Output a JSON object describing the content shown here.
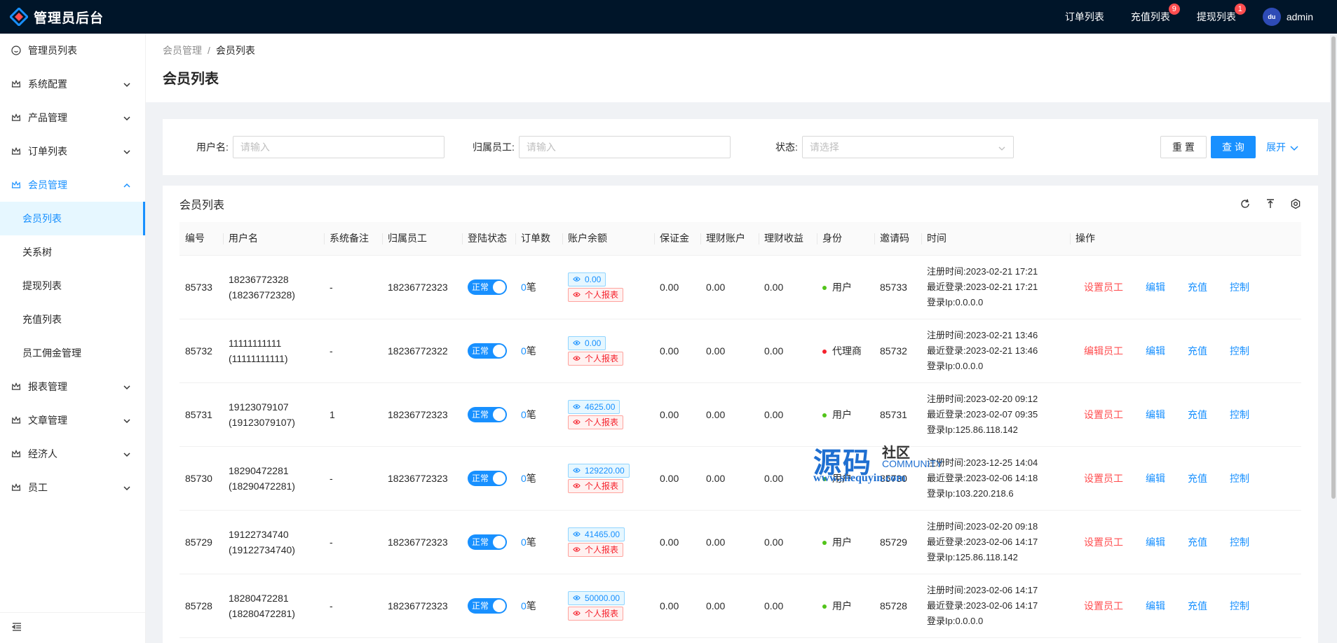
{
  "app": {
    "title": "管理员后台"
  },
  "topnav": [
    {
      "label": "订单列表",
      "badge": ""
    },
    {
      "label": "充值列表",
      "badge": "9"
    },
    {
      "label": "提现列表",
      "badge": "1"
    }
  ],
  "user": {
    "name": "admin",
    "avatar_text": "du"
  },
  "sidebar": {
    "items": [
      {
        "label": "管理员列表",
        "icon": "smile-icon",
        "expandable": false
      },
      {
        "label": "系统配置",
        "icon": "crown-icon",
        "expandable": true
      },
      {
        "label": "产品管理",
        "icon": "crown-icon",
        "expandable": true
      },
      {
        "label": "订单列表",
        "icon": "crown-icon",
        "expandable": true
      },
      {
        "label": "会员管理",
        "icon": "crown-icon",
        "expandable": true,
        "open": true,
        "children": [
          {
            "label": "会员列表",
            "selected": true
          },
          {
            "label": "关系树"
          },
          {
            "label": "提现列表"
          },
          {
            "label": "充值列表"
          },
          {
            "label": "员工佣金管理"
          }
        ]
      },
      {
        "label": "报表管理",
        "icon": "crown-icon",
        "expandable": true
      },
      {
        "label": "文章管理",
        "icon": "crown-icon",
        "expandable": true
      },
      {
        "label": "经济人",
        "icon": "crown-icon",
        "expandable": true
      },
      {
        "label": "员工",
        "icon": "crown-icon",
        "expandable": true
      }
    ]
  },
  "breadcrumb": {
    "parent": "会员管理",
    "sep": "/",
    "current": "会员列表"
  },
  "page_title": "会员列表",
  "search": {
    "username_label": "用户名:",
    "username_placeholder": "请输入",
    "staff_label": "归属员工:",
    "staff_placeholder": "请输入",
    "status_label": "状态:",
    "status_placeholder": "请选择",
    "reset": "重 置",
    "query": "查 询",
    "expand": "展开"
  },
  "table": {
    "title": "会员列表",
    "columns": [
      "编号",
      "用户名",
      "系统备注",
      "归属员工",
      "登陆状态",
      "订单数",
      "账户余额",
      "保证金",
      "理财账户",
      "理财收益",
      "身份",
      "邀请码",
      "时间",
      "操作"
    ],
    "switch_label": "正常",
    "count_suffix": "笔",
    "report_label": "个人报表",
    "reg_prefix": "注册时间:",
    "last_prefix": "最近登录:",
    "ip_prefix": "登录Ip:",
    "rows": [
      {
        "id": "85733",
        "user": "18236772328",
        "user2": "(18236772328)",
        "remark": "-",
        "staff": "18236772323",
        "orders": "0",
        "balance": "0.00",
        "deposit": "0.00",
        "finance": "0.00",
        "income": "0.00",
        "role": "用户",
        "role_color": "#52c41a",
        "code": "85733",
        "reg": "2023-02-21 17:21",
        "last": "2023-02-21 17:21",
        "ip": "0.0.0.0",
        "a1": "设置员工",
        "a2": "编辑",
        "a3": "充值",
        "a4": "控制"
      },
      {
        "id": "85732",
        "user": "11111111111",
        "user2": "(11111111111)",
        "remark": "-",
        "staff": "18236772322",
        "orders": "0",
        "balance": "0.00",
        "deposit": "0.00",
        "finance": "0.00",
        "income": "0.00",
        "role": "代理商",
        "role_color": "#f5222d",
        "code": "85732",
        "reg": "2023-02-21 13:46",
        "last": "2023-02-21 13:46",
        "ip": "0.0.0.0",
        "a1": "编辑员工",
        "a2": "编辑",
        "a3": "充值",
        "a4": "控制"
      },
      {
        "id": "85731",
        "user": "19123079107",
        "user2": "(19123079107)",
        "remark": "1",
        "staff": "18236772323",
        "orders": "0",
        "balance": "4625.00",
        "deposit": "0.00",
        "finance": "0.00",
        "income": "0.00",
        "role": "用户",
        "role_color": "#52c41a",
        "code": "85731",
        "reg": "2023-02-20 09:12",
        "last": "2023-02-07 09:35",
        "ip": "125.86.118.142",
        "a1": "设置员工",
        "a2": "编辑",
        "a3": "充值",
        "a4": "控制"
      },
      {
        "id": "85730",
        "user": "18290472281",
        "user2": "(18290472281)",
        "remark": "-",
        "staff": "18236772323",
        "orders": "0",
        "balance": "129220.00",
        "deposit": "0.00",
        "finance": "0.00",
        "income": "0.00",
        "role": "用户",
        "role_color": "#52c41a",
        "code": "85730",
        "reg": "2023-12-25 14:04",
        "last": "2023-02-06 14:18",
        "ip": "103.220.218.6",
        "a1": "设置员工",
        "a2": "编辑",
        "a3": "充值",
        "a4": "控制"
      },
      {
        "id": "85729",
        "user": "19122734740",
        "user2": "(19122734740)",
        "remark": "-",
        "staff": "18236772323",
        "orders": "0",
        "balance": "41465.00",
        "deposit": "0.00",
        "finance": "0.00",
        "income": "0.00",
        "role": "用户",
        "role_color": "#52c41a",
        "code": "85729",
        "reg": "2023-02-20 09:18",
        "last": "2023-02-06 14:17",
        "ip": "125.86.118.142",
        "a1": "设置员工",
        "a2": "编辑",
        "a3": "充值",
        "a4": "控制"
      },
      {
        "id": "85728",
        "user": "18280472281",
        "user2": "(18280472281)",
        "remark": "-",
        "staff": "18236772323",
        "orders": "0",
        "balance": "50000.00",
        "deposit": "0.00",
        "finance": "0.00",
        "income": "0.00",
        "role": "用户",
        "role_color": "#52c41a",
        "code": "85728",
        "reg": "2023-02-06 14:17",
        "last": "2023-02-06 14:17",
        "ip": "0.0.0.0",
        "a1": "设置员工",
        "a2": "编辑",
        "a3": "充值",
        "a4": "控制"
      }
    ]
  },
  "watermark": {
    "big": "源码",
    "cn": "社区",
    "en": "COMMUNITY",
    "url": "www.shequyin.com"
  },
  "colors": {
    "topbar": "#001529",
    "primary": "#1890ff",
    "danger": "#ff4d4f",
    "success": "#52c41a"
  }
}
